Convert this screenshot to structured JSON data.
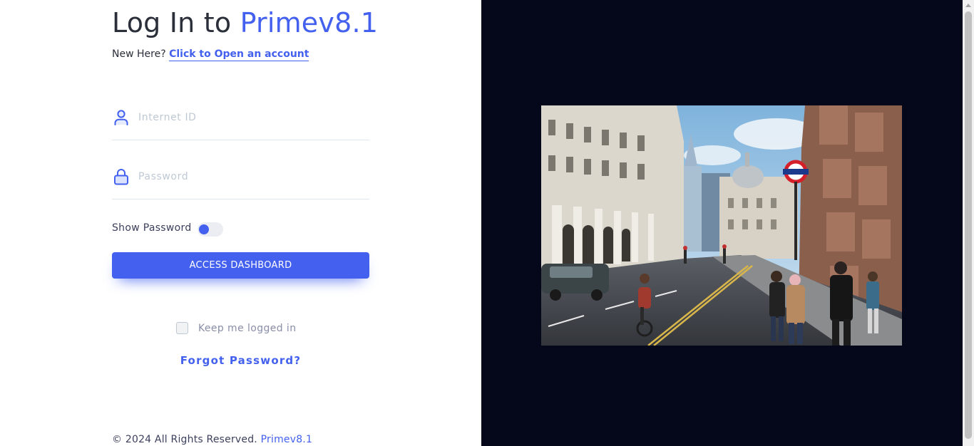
{
  "login": {
    "title_prefix": "Log In to",
    "title_brand": "Primev8.1",
    "new_here": "New Here?",
    "open_account_link": "Click to Open an account",
    "internet_id_placeholder": "Internet ID",
    "internet_id_value": "",
    "password_placeholder": "Password",
    "password_value": "",
    "show_password_label": "Show Password",
    "show_password_on": false,
    "submit_label": "ACCESS DASHBOARD",
    "keep_logged_in_label": "Keep me logged in",
    "keep_logged_in_checked": false,
    "forgot_password": "Forgot Password?"
  },
  "footer": {
    "copyright": "© 2024 All Rights Reserved.",
    "brand": "Primev8.1"
  },
  "colors": {
    "accent": "#4361ee",
    "right_panel": "#05081a",
    "text": "#2b2f3a",
    "placeholder": "#bfc9d4"
  },
  "icons": {
    "user": "user-icon",
    "lock": "lock-icon"
  }
}
